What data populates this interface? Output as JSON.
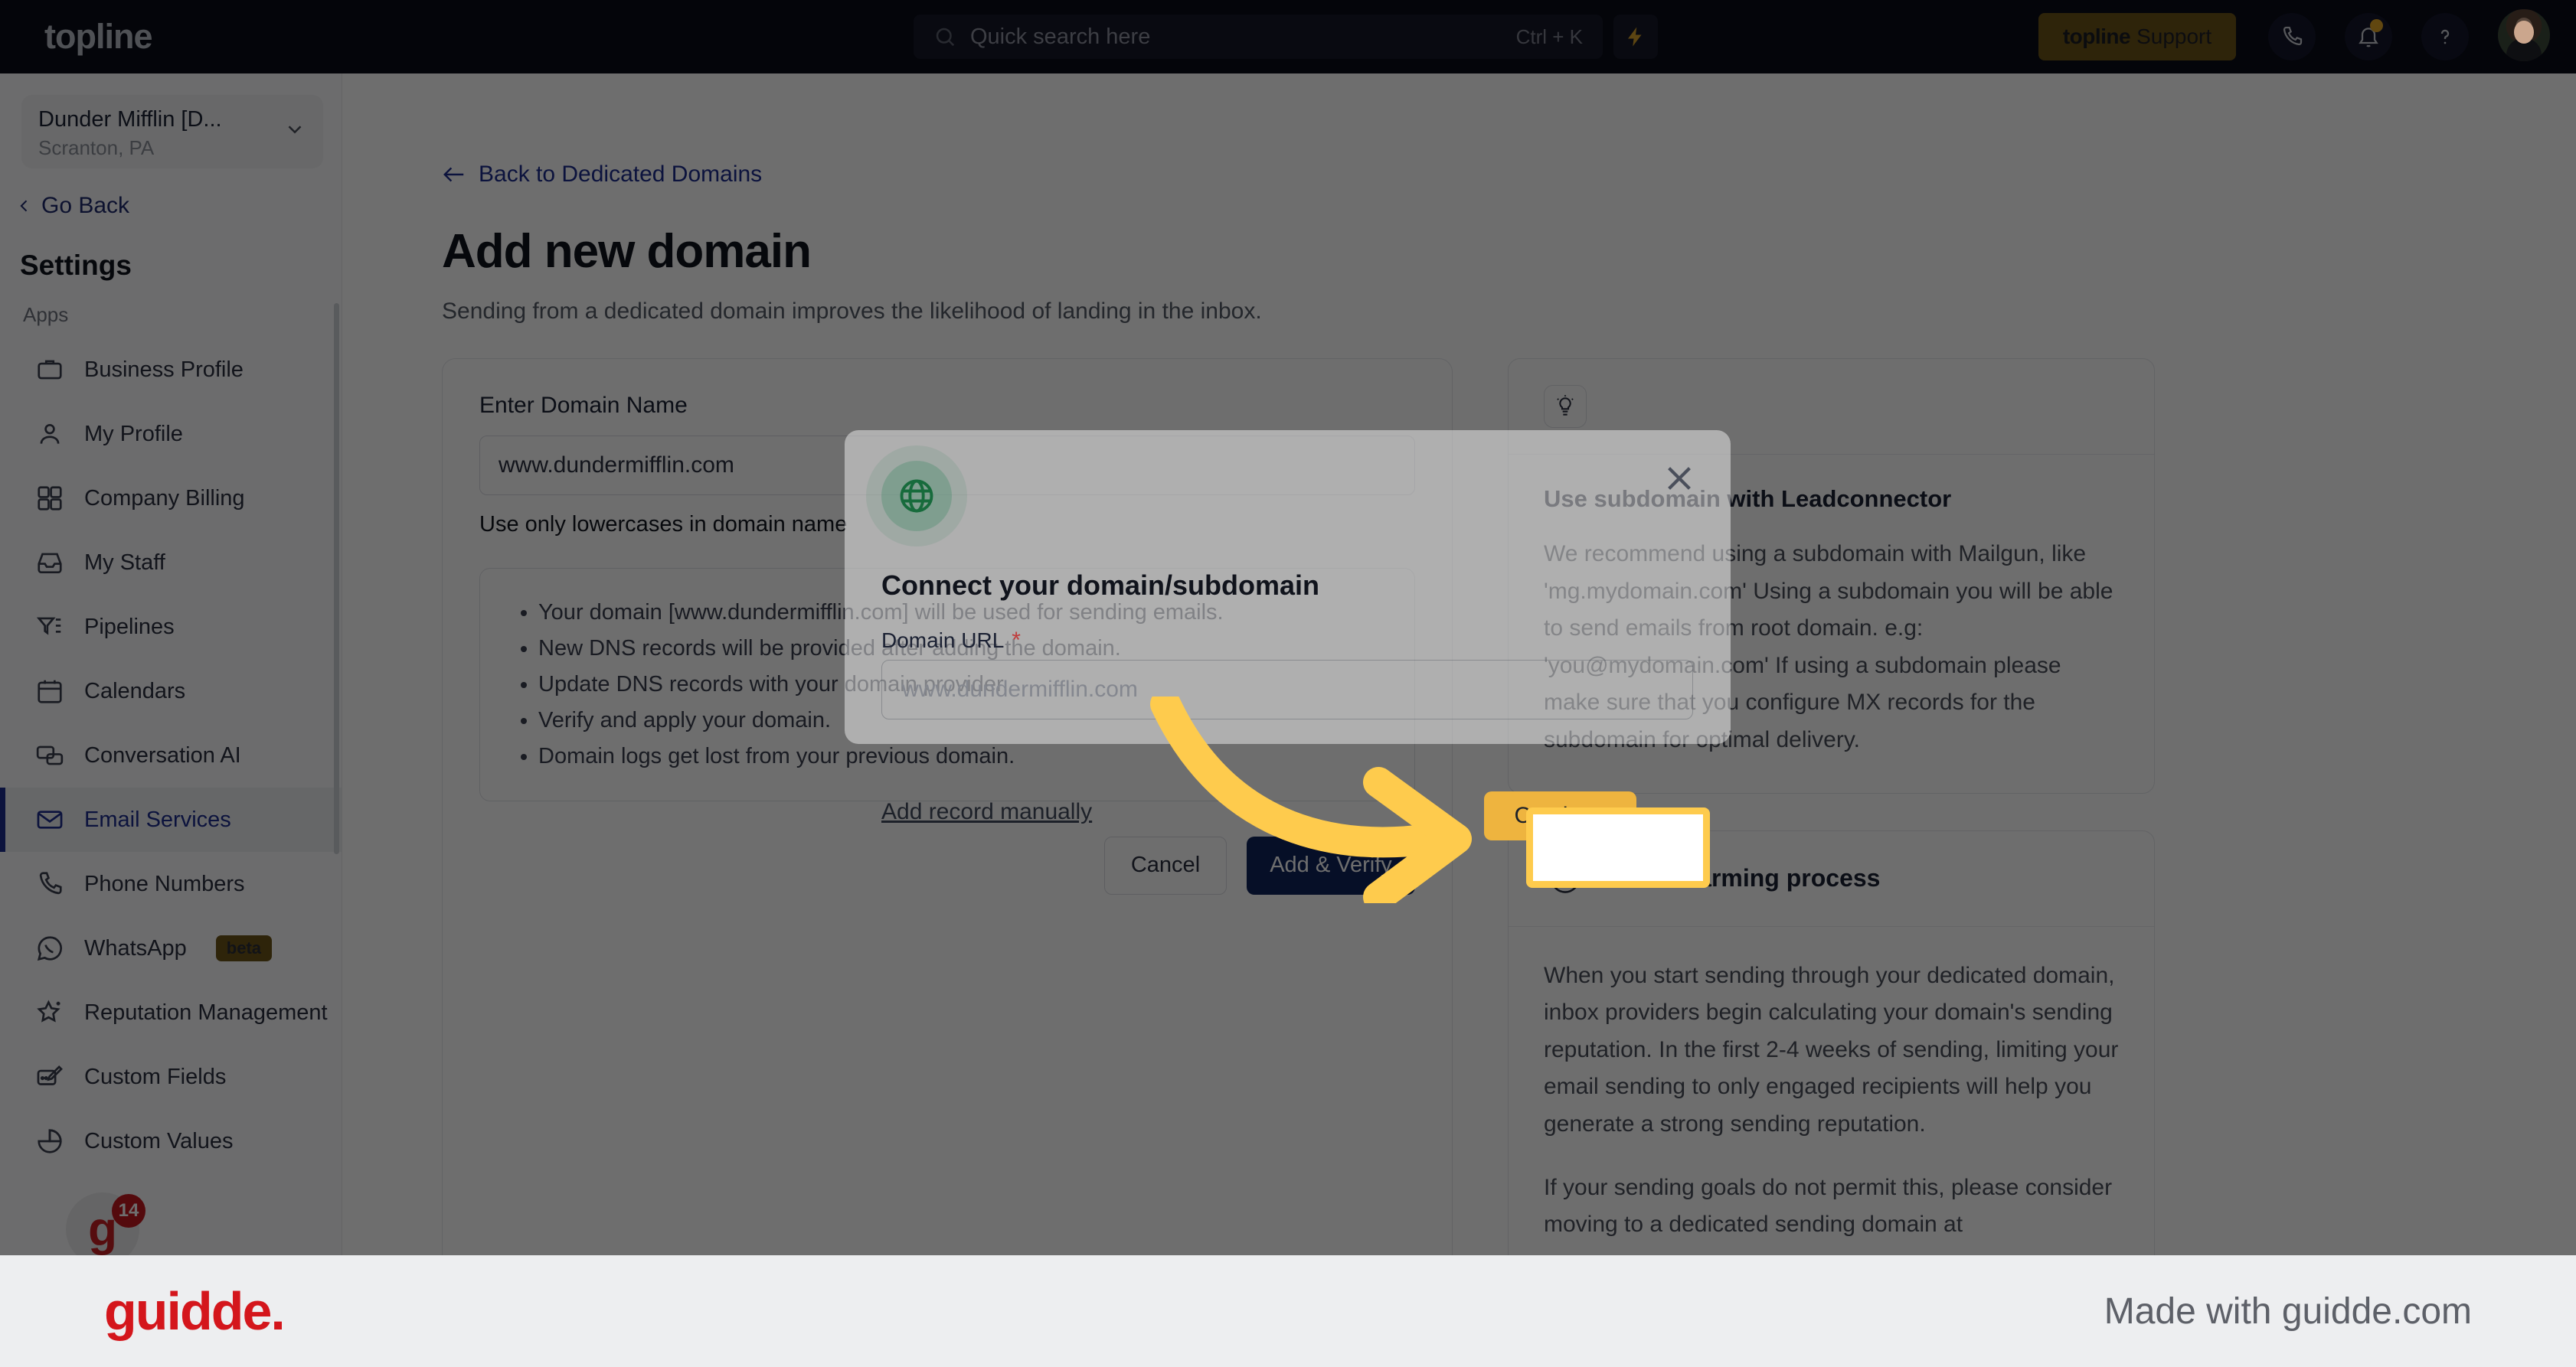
{
  "topbar": {
    "logo": "topline",
    "search_placeholder": "Quick search here",
    "search_shortcut": "Ctrl + K",
    "bolt_icon": "lightning-bolt-icon",
    "support_logo": "topline",
    "support_label": "Support",
    "phone_icon": "phone-icon",
    "bell_icon": "bell-icon",
    "help_icon": "question-mark-icon",
    "avatar": "user-avatar"
  },
  "sidebar": {
    "location_name": "Dunder Mifflin [D...",
    "location_sub": "Scranton, PA",
    "go_back": "Go Back",
    "settings_heading": "Settings",
    "group_label": "Apps",
    "items": [
      {
        "label": "Business Profile",
        "icon": "briefcase-icon",
        "active": false
      },
      {
        "label": "My Profile",
        "icon": "person-icon",
        "active": false
      },
      {
        "label": "Company Billing",
        "icon": "calculator-icon",
        "active": false
      },
      {
        "label": "My Staff",
        "icon": "inbox-icon",
        "active": false
      },
      {
        "label": "Pipelines",
        "icon": "filter-icon",
        "active": false
      },
      {
        "label": "Calendars",
        "icon": "calendar-icon",
        "active": false
      },
      {
        "label": "Conversation AI",
        "icon": "chat-bubbles-icon",
        "active": false
      },
      {
        "label": "Email Services",
        "icon": "envelope-icon",
        "active": true
      },
      {
        "label": "Phone Numbers",
        "icon": "phone-icon",
        "active": false
      },
      {
        "label": "WhatsApp",
        "icon": "whatsapp-icon",
        "active": false,
        "badge": "beta"
      },
      {
        "label": "Reputation Management",
        "icon": "star-sparkle-icon",
        "active": false
      },
      {
        "label": "Custom Fields",
        "icon": "edit-field-icon",
        "active": false
      },
      {
        "label": "Custom Values",
        "icon": "pie-chart-icon",
        "active": false
      }
    ],
    "float_badge_letter": "g",
    "float_badge_count": "14"
  },
  "main": {
    "back_link": "Back to Dedicated Domains",
    "title": "Add new domain",
    "subtitle": "Sending from a dedicated domain improves the likelihood of landing in the inbox.",
    "form": {
      "field_label": "Enter Domain Name",
      "field_value": "www.dundermifflin.com",
      "hint": "Use only lowercases in domain name",
      "bullets": [
        "Your domain [www.dundermifflin.com] will be used for sending emails.",
        "New DNS records will be provided after adding the domain.",
        "Update DNS records with your domain provider.",
        "Verify and apply your domain.",
        "Domain logs get lost from your previous domain."
      ],
      "cancel_label": "Cancel",
      "verify_label": "Add & Verify"
    }
  },
  "aside": [
    {
      "icon": "lightbulb-icon",
      "head_title": "",
      "body_title": "Use subdomain with Leadconnector",
      "paragraphs": [
        "We recommend using a subdomain with Mailgun, like 'mg.mydomain.com' Using a subdomain you will be able to send emails from root domain. e.g: 'you@mydomain.com' If using a subdomain please make sure that you configure MX records for the subdomain for optimal delivery."
      ]
    },
    {
      "icon": "info-circle-icon",
      "head_title": "Email warming process",
      "body_title": "",
      "paragraphs": [
        "When you start sending through your dedicated domain, inbox providers begin calculating your domain's sending reputation. In the first 2-4 weeks of sending, limiting your email sending to only engaged recipients will help you generate a strong sending reputation.",
        "If your sending goals do not permit this, please consider moving to a dedicated sending domain at"
      ]
    }
  ],
  "modal": {
    "globe_icon": "globe-icon",
    "close_icon": "close-icon",
    "title": "Connect your domain/subdomain",
    "field_label": "Domain URL",
    "required_marker": "*",
    "input_placeholder": "www.dundermifflin.com",
    "manual_link": "Add record manually",
    "continue_label": "Continue"
  },
  "footer": {
    "logo": "guidde.",
    "made_with": "Made with guidde.com"
  },
  "colors": {
    "topbar_bg": "#0a0c18",
    "accent_navy": "#1c2d8e",
    "primary_button": "#10245c",
    "highlight_yellow": "#fecb4d",
    "continue_button": "#eeb43f",
    "guidde_red": "#d4161c",
    "globe_green": "#176b3c"
  }
}
